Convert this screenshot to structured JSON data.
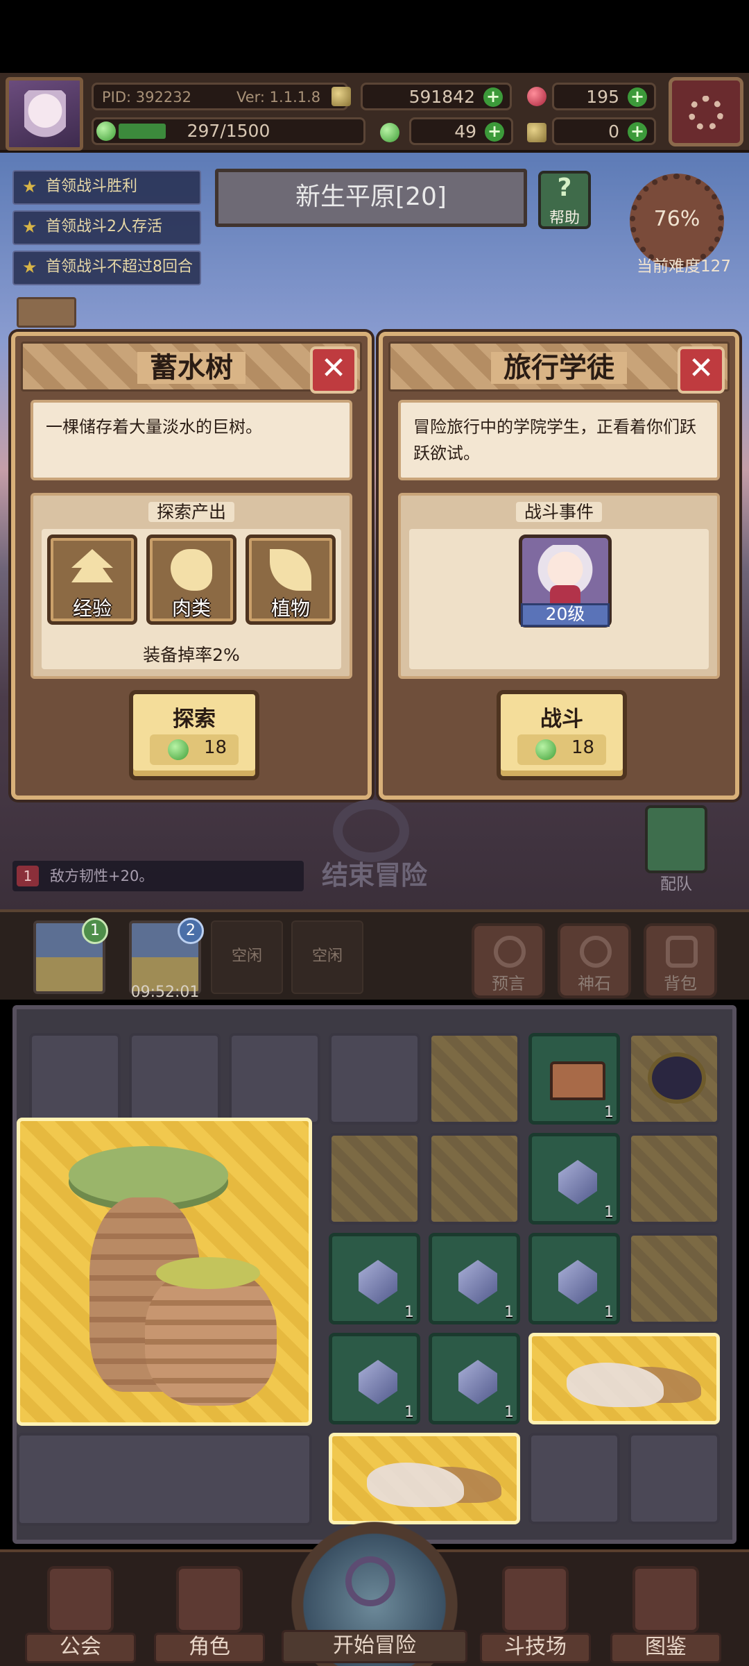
{
  "top_bar": {
    "pid": "PID: 392232",
    "version": "Ver: 1.1.1.8",
    "gold": "591842",
    "red_gems": "195",
    "energy": "297/1500",
    "energy_fraction": 0.198,
    "clover": "49",
    "keys": "0"
  },
  "quests": [
    "首领战斗胜利",
    "首领战斗2人存活",
    "首领战斗不超过8回合"
  ],
  "stage": {
    "name": "新生平原[20]",
    "help_label": "帮助",
    "difficulty_pct": "76%",
    "difficulty_label": "当前难度127"
  },
  "card_left": {
    "title": "蓄水树",
    "description": "一棵储存着大量淡水的巨树。",
    "section_title": "探索产出",
    "outputs": [
      "经验",
      "肉类",
      "植物"
    ],
    "drop_rate": "装备掉率2%",
    "button_label": "探索",
    "cost": "18"
  },
  "card_right": {
    "title": "旅行学徒",
    "description": "冒险旅行中的学院学生，正看着你们跃跃欲试。",
    "section_title": "战斗事件",
    "enemy_level": "20级",
    "button_label": "战斗",
    "cost": "18"
  },
  "middle": {
    "end_adventure": "结束冒险",
    "formation": "配队",
    "buff_index": "1",
    "buff_text": "敌方韧性+20。"
  },
  "expeditions": {
    "slot1_badge": "1",
    "slot2_badge": "2",
    "slot2_timer": "09:52:01",
    "empty_label": "空闲",
    "tools": [
      "预言",
      "神石",
      "背包"
    ]
  },
  "inventory": {
    "count": "1"
  },
  "bottom_nav": [
    "公会",
    "角色",
    "开始冒险",
    "斗技场",
    "图鉴"
  ],
  "colors": {
    "green_gem": "#3f9e37",
    "red_gem": "#a7233b",
    "close_red": "#bf3b3f",
    "highlight_yellow": "#f1c84e"
  }
}
